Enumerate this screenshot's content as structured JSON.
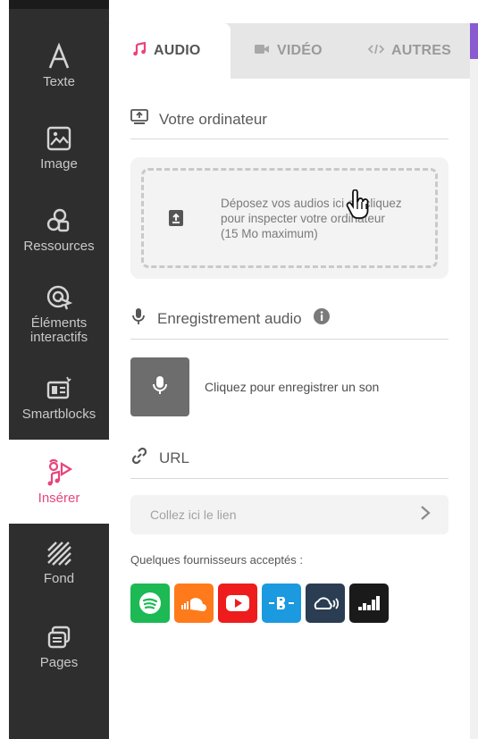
{
  "colors": {
    "accent": "#e8457c",
    "sidebar": "#2e2e2e",
    "sidebar_text": "#c9c9c9"
  },
  "sidebar": {
    "items": [
      {
        "label": "Texte",
        "icon": "text-icon",
        "active": false
      },
      {
        "label": "Image",
        "icon": "image-icon",
        "active": false
      },
      {
        "label": "Ressources",
        "icon": "resources-icon",
        "active": false
      },
      {
        "label": "Éléments\ninteractifs",
        "icon": "interactive-icon",
        "active": false
      },
      {
        "label": "Smartblocks",
        "icon": "smartblocks-icon",
        "active": false
      },
      {
        "label": "Insérer",
        "icon": "insert-media-icon",
        "active": true
      },
      {
        "label": "Fond",
        "icon": "background-icon",
        "active": false
      },
      {
        "label": "Pages",
        "icon": "pages-icon",
        "active": false
      }
    ]
  },
  "tabs": [
    {
      "label": "AUDIO",
      "icon": "music-note-icon",
      "active": true
    },
    {
      "label": "VIDÉO",
      "icon": "video-camera-icon",
      "active": false
    },
    {
      "label": "AUTRES",
      "icon": "code-icon",
      "active": false
    }
  ],
  "computer_section": {
    "title": "Votre ordinateur",
    "icon": "upload-computer-icon",
    "drop_text": "Déposez vos audios ici ou cliquez pour inspecter votre ordinateur (15 Mo maximum)"
  },
  "recording_section": {
    "title": "Enregistrement audio",
    "info_icon": "info-icon",
    "record_text": "Cliquez pour enregistrer un son"
  },
  "url_section": {
    "title": "URL",
    "placeholder": "Collez ici le lien"
  },
  "providers": {
    "label": "Quelques fournisseurs acceptés :",
    "items": [
      {
        "name": "spotify-icon",
        "color": "#1db954"
      },
      {
        "name": "soundcloud-icon",
        "color": "#ff7a1a"
      },
      {
        "name": "youtube-icon",
        "color": "#ee1c1c"
      },
      {
        "name": "bandcamp-icon",
        "color": "#1b9ae0"
      },
      {
        "name": "mixcloud-icon",
        "color": "#2a3d52"
      },
      {
        "name": "deezer-icon",
        "color": "#1a1a1a"
      }
    ]
  }
}
